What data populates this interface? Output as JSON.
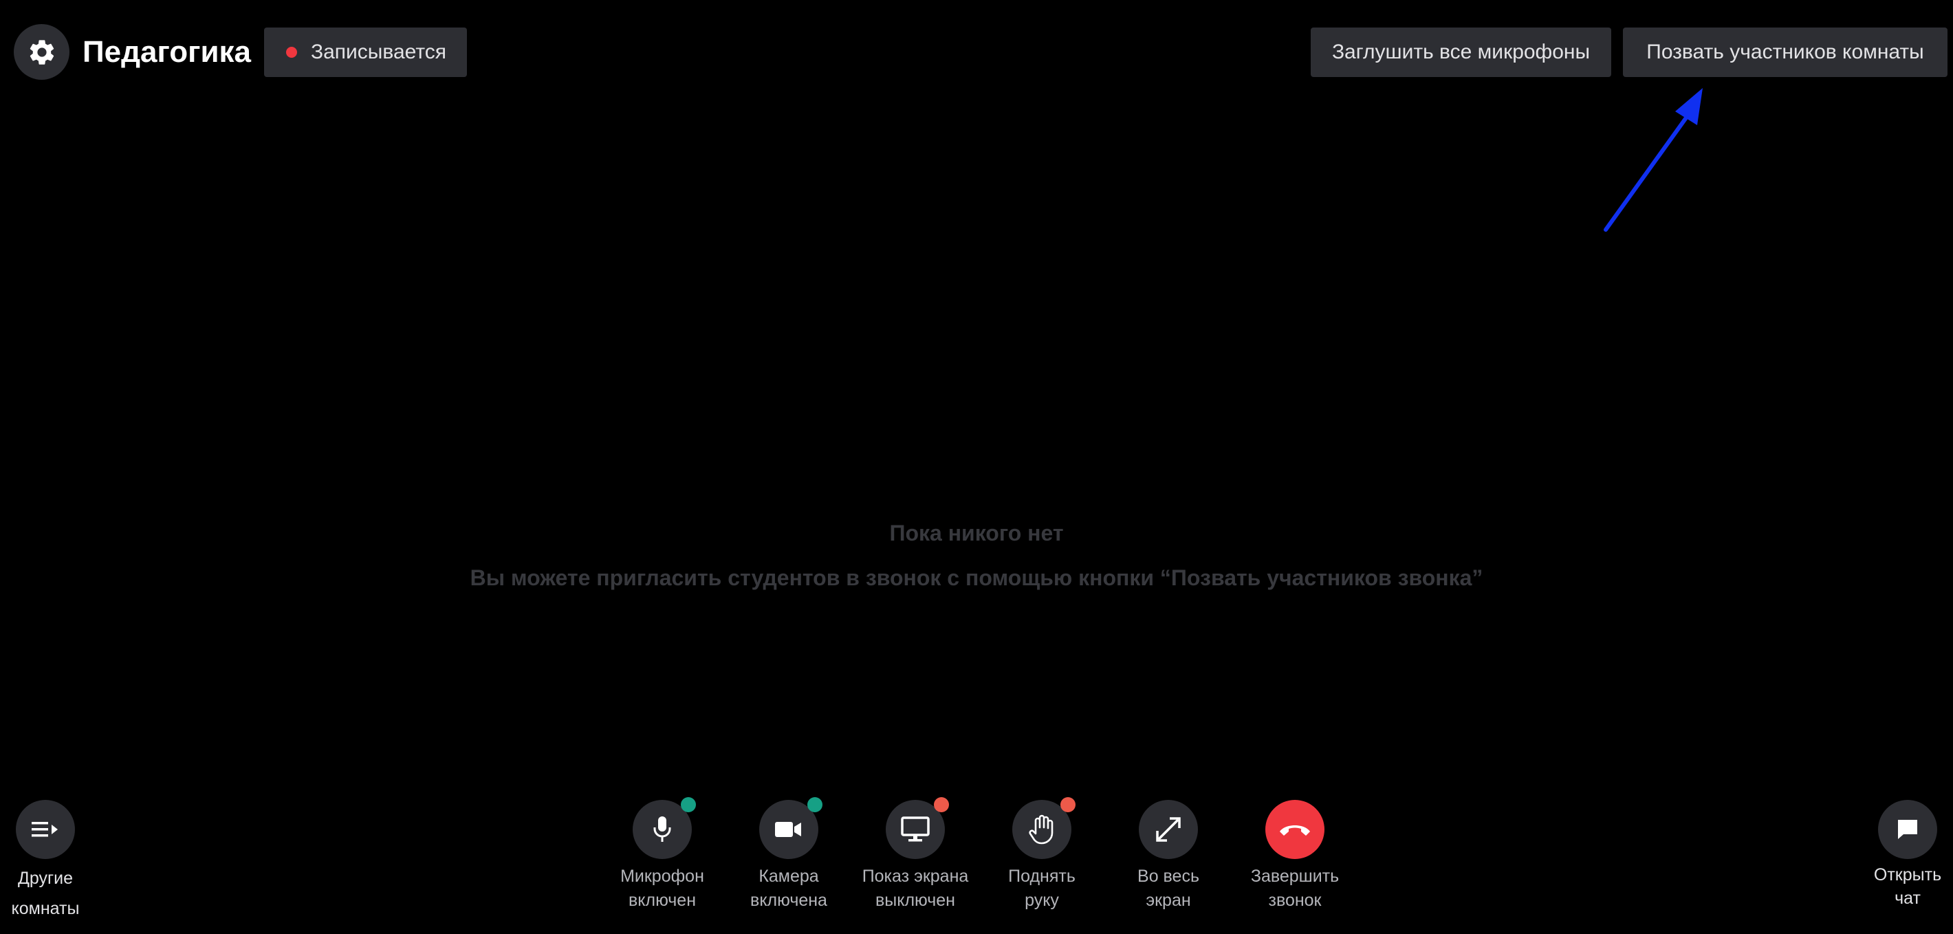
{
  "header": {
    "settings_icon": "gear-icon",
    "room_title": "Педагогика",
    "recording_label": "Записывается",
    "recording_color": "#f0373f",
    "mute_all_label": "Заглушить все микрофоны",
    "invite_label": "Позвать участников комнаты"
  },
  "empty_state": {
    "title": "Пока никого нет",
    "subtitle": "Вы можете пригласить студентов в звонок с помощью кнопки “Позвать участников звонка”"
  },
  "controls": {
    "other_rooms": {
      "icon": "list-arrow-icon",
      "line1": "Другие",
      "line2": "комнаты"
    },
    "mic": {
      "icon": "microphone-icon",
      "line1": "Микрофон",
      "line2": "включен",
      "status_color": "#16a085"
    },
    "camera": {
      "icon": "video-camera-icon",
      "line1": "Камера",
      "line2": "включена",
      "status_color": "#16a085"
    },
    "screen": {
      "icon": "monitor-icon",
      "line1": "Показ экрана",
      "line2": "выключен",
      "status_color": "#ed5a4a"
    },
    "hand": {
      "icon": "raise-hand-icon",
      "line1": "Поднять",
      "line2": "руку",
      "status_color": "#ed5a4a"
    },
    "fullscreen": {
      "icon": "expand-icon",
      "line1": "Во весь",
      "line2": "экран"
    },
    "end_call": {
      "icon": "hang-up-icon",
      "line1": "Завершить",
      "line2": "звонок",
      "color": "#f0373f"
    },
    "chat": {
      "icon": "chat-bubble-icon",
      "line1": "Открыть",
      "line2": "чат"
    }
  },
  "annotation": {
    "arrow_color": "#1030f0"
  }
}
